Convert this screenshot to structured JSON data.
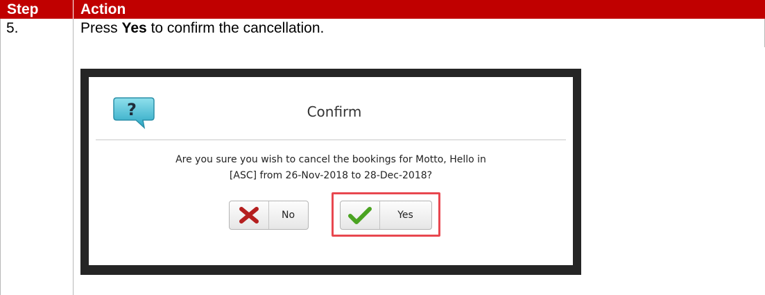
{
  "table": {
    "headers": {
      "step": "Step",
      "action": "Action"
    },
    "row": {
      "step": "5.",
      "action_prefix": "Press ",
      "action_bold": "Yes",
      "action_suffix": " to confirm the cancellation."
    }
  },
  "dialog": {
    "title": "Confirm",
    "icon": "question-speech-bubble-icon",
    "message_line1": "Are you sure you wish to cancel the bookings for Motto, Hello in",
    "message_line2": "[ASC] from 26-Nov-2018 to 28-Dec-2018?",
    "buttons": {
      "no": {
        "label": "No",
        "icon": "red-x-icon"
      },
      "yes": {
        "label": "Yes",
        "icon": "green-check-icon"
      }
    }
  },
  "colors": {
    "header_bg": "#c00000",
    "highlight": "#e8474f",
    "frame": "#252525"
  }
}
